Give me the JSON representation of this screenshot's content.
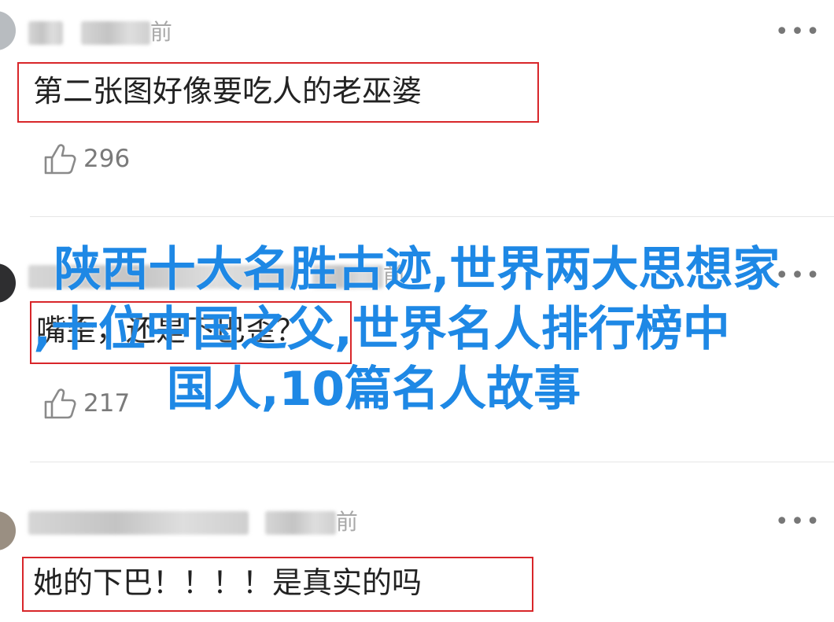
{
  "comments": [
    {
      "time_suffix": "前",
      "text": "第二张图好像要吃人的老巫婆",
      "likes": "296",
      "more": "•••"
    },
    {
      "time_suffix": "前",
      "text": "嘴歪，还是下巴歪？",
      "likes": "217",
      "more": "•••"
    },
    {
      "time_suffix": "前",
      "text": "她的下巴！！！！是真实的吗",
      "more": "•••"
    }
  ],
  "overlay_title": {
    "line1": "陕西十大名胜古迹,世界两大思想家",
    "line2": ",十位中国之父,世界名人排行榜中",
    "line3": "国人,10篇名人故事"
  },
  "colors": {
    "highlight_border": "#d8262a",
    "overlay_text": "#1e88e5"
  },
  "icons": {
    "like": "thumbs-up-icon",
    "more": "more-dots-icon"
  }
}
